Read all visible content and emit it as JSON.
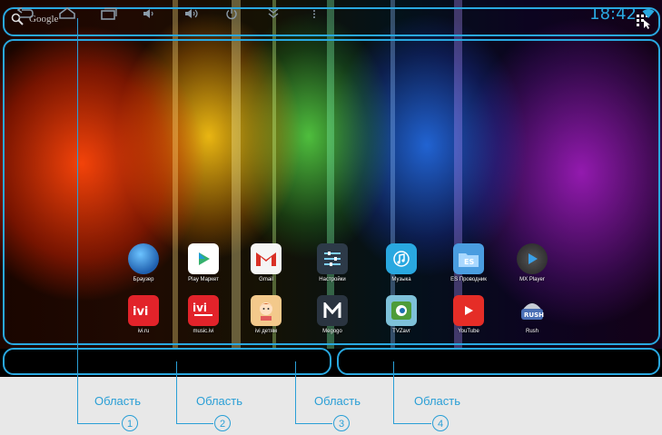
{
  "search": {
    "label": "Google"
  },
  "apps": [
    {
      "label": "Браузер",
      "icon": "globe-icon"
    },
    {
      "label": "Play Маркет",
      "icon": "play-market-icon"
    },
    {
      "label": "Gmail",
      "icon": "gmail-icon"
    },
    {
      "label": "Настройки",
      "icon": "settings-icon"
    },
    {
      "label": "Музыка",
      "icon": "music-icon"
    },
    {
      "label": "ES Проводник",
      "icon": "es-explorer-icon"
    },
    {
      "label": "MX Player",
      "icon": "mx-player-icon"
    },
    {
      "label": "ivi.ru",
      "icon": "ivi-icon"
    },
    {
      "label": "music.ivi",
      "icon": "music-ivi-icon"
    },
    {
      "label": "ivi детям",
      "icon": "ivi-kids-icon"
    },
    {
      "label": "Megogo",
      "icon": "megogo-icon"
    },
    {
      "label": "TVZavr",
      "icon": "tvzavr-icon"
    },
    {
      "label": "YouTube",
      "icon": "youtube-icon"
    },
    {
      "label": "Rush",
      "icon": "rush-icon"
    }
  ],
  "status": {
    "time": "18:42"
  },
  "callouts": [
    {
      "label": "Область",
      "number": "1"
    },
    {
      "label": "Область",
      "number": "2"
    },
    {
      "label": "Область",
      "number": "3"
    },
    {
      "label": "Область",
      "number": "4"
    }
  ],
  "colors": {
    "accent": "#29a8e0",
    "callout": "#2a9fd6"
  }
}
